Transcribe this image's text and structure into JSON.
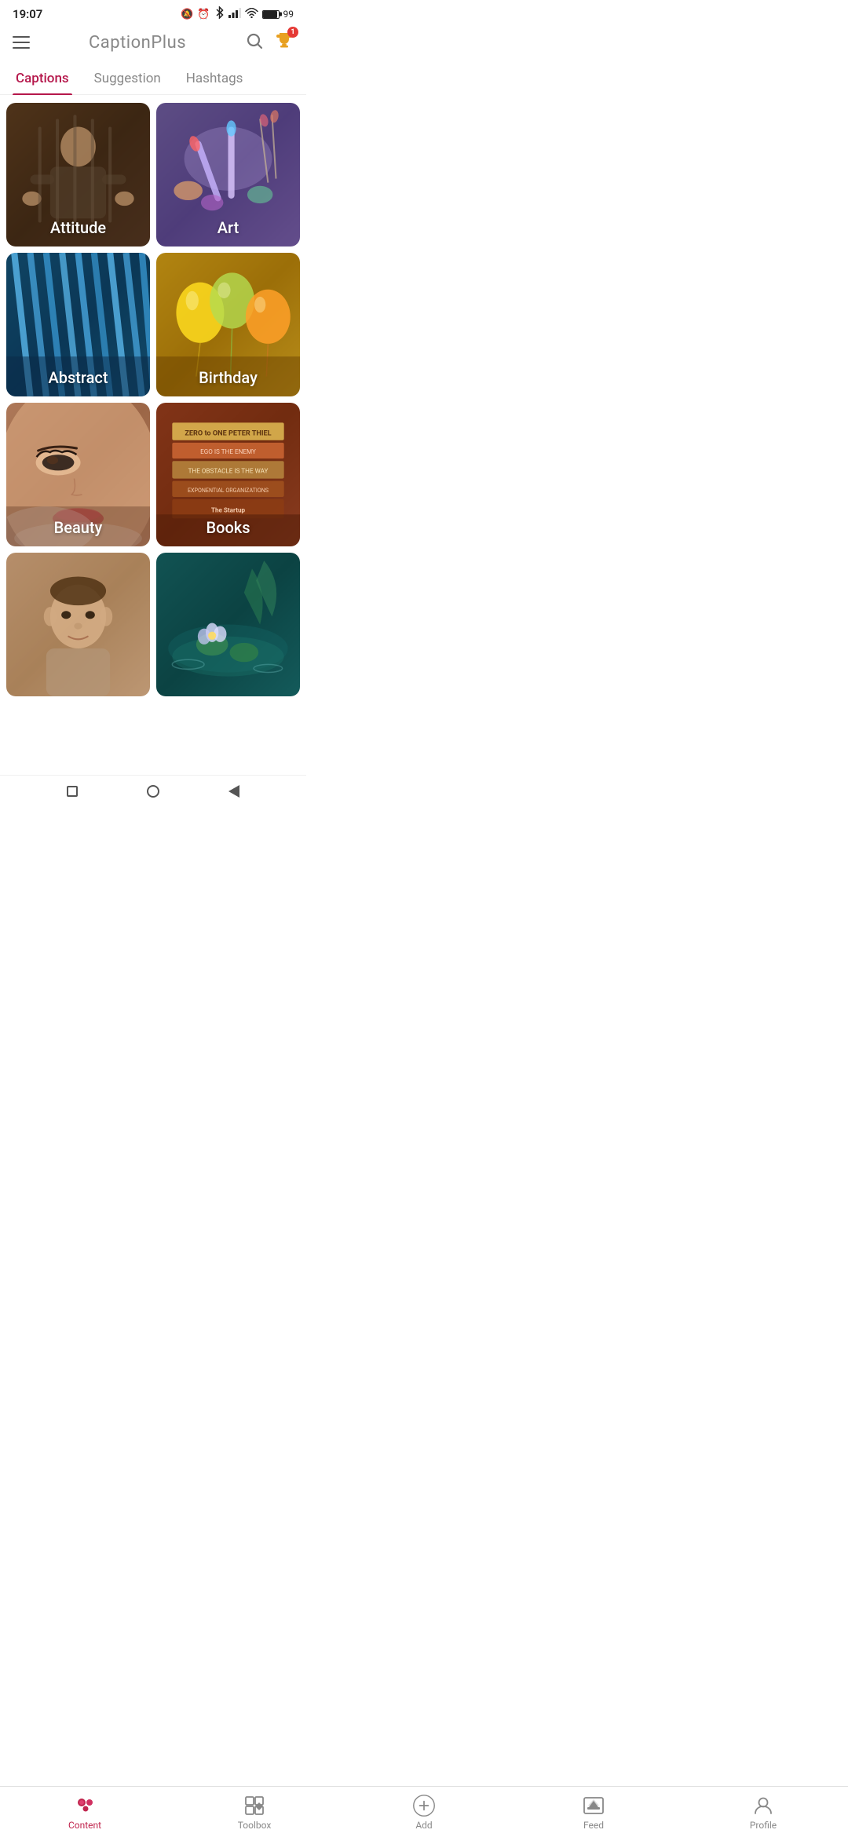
{
  "statusBar": {
    "time": "19:07",
    "battery": "99"
  },
  "header": {
    "title": "CaptionPlus",
    "menu_label": "menu",
    "search_label": "search",
    "trophy_label": "trophy",
    "trophy_badge": "1"
  },
  "tabs": [
    {
      "id": "captions",
      "label": "Captions",
      "active": true
    },
    {
      "id": "suggestion",
      "label": "Suggestion",
      "active": false
    },
    {
      "id": "hashtags",
      "label": "Hashtags",
      "active": false
    }
  ],
  "grid": {
    "items": [
      {
        "id": "attitude",
        "label": "Attitude",
        "bg_class": "bg-attitude"
      },
      {
        "id": "art",
        "label": "Art",
        "bg_class": "bg-art"
      },
      {
        "id": "abstract",
        "label": "Abstract",
        "bg_class": "bg-abstract"
      },
      {
        "id": "birthday",
        "label": "Birthday",
        "bg_class": "bg-birthday"
      },
      {
        "id": "beauty",
        "label": "Beauty",
        "bg_class": "bg-beauty"
      },
      {
        "id": "books",
        "label": "Books",
        "bg_class": "bg-books"
      },
      {
        "id": "boy",
        "label": "",
        "bg_class": "bg-boy"
      },
      {
        "id": "nature",
        "label": "",
        "bg_class": "bg-nature"
      }
    ]
  },
  "bottomNav": {
    "items": [
      {
        "id": "content",
        "label": "Content",
        "active": true
      },
      {
        "id": "toolbox",
        "label": "Toolbox",
        "active": false
      },
      {
        "id": "add",
        "label": "Add",
        "active": false
      },
      {
        "id": "feed",
        "label": "Feed",
        "active": false
      },
      {
        "id": "profile",
        "label": "Profile",
        "active": false
      }
    ]
  }
}
